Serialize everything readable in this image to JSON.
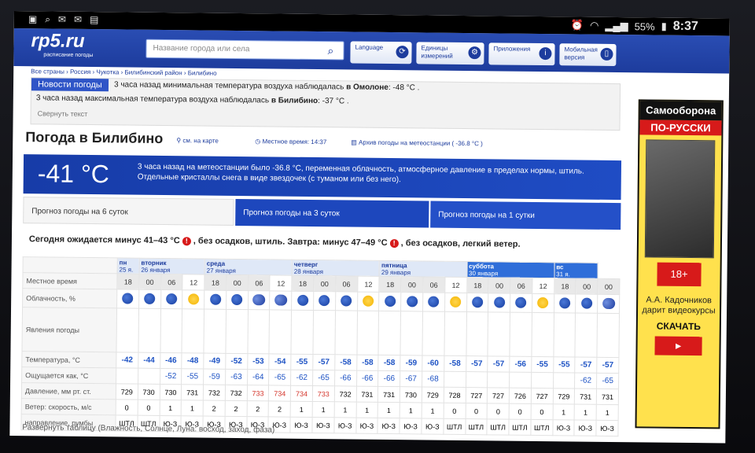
{
  "status_bar": {
    "battery": "55%",
    "time": "8:37"
  },
  "header": {
    "logo": "rp5.ru",
    "logo_sub": "расписание погоды",
    "search_placeholder": "Название города или села",
    "language": "Language",
    "units": "Единицы измерений",
    "apps": "Приложения",
    "mobile": "Мобильная версия"
  },
  "breadcrumb": "Все страны › Россия › Чукотка › Билибинский район › Билибино",
  "news": {
    "tab": "Новости погоды",
    "line1_pre": "3 часа назад минимальная температура воздуха наблюдалась ",
    "line1_bold": "в Омолоне",
    "line1_val": ": -48 °C .",
    "line2_pre": "3 часа назад максимальная температура воздуха наблюдалась ",
    "line2_bold": "в Билибино",
    "line2_val": ": -37 °C .",
    "collapse": "Свернуть текст"
  },
  "title": {
    "text": "Погода в Билибино",
    "map_link": "см. на карте",
    "local_time": "Местное время: 14:37",
    "archive": "Архив погоды на метеостанции ( -36.8 °C )"
  },
  "current": {
    "temp": "-41 °C",
    "desc": "3 часа назад на метеостанции было -36.8 °C, переменная облачность, атмосферное давление в пределах нормы, штиль. Отдельные кристаллы снега в виде звездочек (с туманом или без него)."
  },
  "tabs": {
    "six": "Прогноз погоды на 6 суток",
    "three": "Прогноз погоды на 3 суток",
    "one": "Прогноз погоды на 1 сутки"
  },
  "summary": {
    "today": "Сегодня ожидается минус 41–43 °C",
    "today_rest": ", без осадков, штиль. Завтра: минус 47–49 °C",
    "tomorrow_rest": ", без осадков, легкий ветер."
  },
  "table": {
    "row_labels": [
      "Местное время",
      "Облачность, %",
      "Явления погоды",
      "Температура, °C",
      "Ощущается как, °C",
      "Давление, мм рт. ст.",
      "Ветер: скорость, м/с",
      "направление, румбы"
    ],
    "days": [
      {
        "name": "пн",
        "date": "25 я.",
        "cols": 1,
        "sunday": false
      },
      {
        "name": "вторник",
        "date": "26 января",
        "cols": 3,
        "sunday": false
      },
      {
        "name": "среда",
        "date": "27 января",
        "cols": 4,
        "sunday": false
      },
      {
        "name": "четверг",
        "date": "28 января",
        "cols": 4,
        "sunday": false
      },
      {
        "name": "пятница",
        "date": "29 января",
        "cols": 4,
        "sunday": false
      },
      {
        "name": "суббота",
        "date": "30 января",
        "cols": 4,
        "sunday": true
      },
      {
        "name": "вс",
        "date": "31 я.",
        "cols": 2,
        "sunday": true
      }
    ],
    "hours": [
      "18",
      "00",
      "06",
      "12",
      "18",
      "00",
      "06",
      "12",
      "18",
      "00",
      "06",
      "12",
      "18",
      "00",
      "06",
      "12",
      "18",
      "00",
      "06",
      "12",
      "18",
      "00",
      "00"
    ],
    "clouds": [
      "night",
      "night",
      "night",
      "sun",
      "night",
      "night",
      "cloud",
      "cloud",
      "night",
      "night",
      "night",
      "sun",
      "night",
      "night",
      "night",
      "sun",
      "night",
      "night",
      "night",
      "sun",
      "night",
      "night",
      "cloud"
    ],
    "temp": [
      "-42",
      "-44",
      "-46",
      "-48",
      "-49",
      "-52",
      "-53",
      "-54",
      "-55",
      "-57",
      "-58",
      "-58",
      "-58",
      "-59",
      "-60",
      "-58",
      "-57",
      "-57",
      "-56",
      "-55",
      "-55",
      "-57",
      "-57"
    ],
    "feels": [
      "",
      "",
      "-52",
      "-55",
      "-59",
      "-63",
      "-64",
      "-65",
      "-62",
      "-65",
      "-66",
      "-66",
      "-66",
      "-67",
      "-68",
      "",
      "",
      "",
      "",
      "",
      "",
      "-62",
      "-65"
    ],
    "pressure": [
      "729",
      "730",
      "730",
      "731",
      "732",
      "732",
      "733",
      "734",
      "734",
      "733",
      "732",
      "731",
      "731",
      "730",
      "729",
      "728",
      "727",
      "727",
      "726",
      "727",
      "729",
      "731",
      "731"
    ],
    "pressure_red": [
      false,
      false,
      false,
      false,
      false,
      false,
      true,
      true,
      true,
      true,
      false,
      false,
      false,
      false,
      false,
      false,
      false,
      false,
      false,
      false,
      false,
      false,
      false
    ],
    "wind": [
      "0",
      "0",
      "1",
      "1",
      "2",
      "2",
      "2",
      "2",
      "1",
      "1",
      "1",
      "1",
      "1",
      "1",
      "1",
      "0",
      "0",
      "0",
      "0",
      "0",
      "1",
      "1",
      "1"
    ],
    "dir": [
      "ШТЛ",
      "ШТЛ",
      "Ю-З",
      "Ю-З",
      "Ю-З",
      "Ю-З",
      "Ю-З",
      "Ю-З",
      "Ю-З",
      "Ю-З",
      "Ю-З",
      "Ю-З",
      "Ю-З",
      "Ю-З",
      "Ю-З",
      "ШТЛ",
      "ШТЛ",
      "ШТЛ",
      "ШТЛ",
      "ШТЛ",
      "Ю-З",
      "Ю-З",
      "Ю-З"
    ]
  },
  "expand_table": "Развернуть таблицу (Влажность, Солнце, Луна: восход, заход, фаза)",
  "ad": {
    "head1": "Самооборона",
    "head2": "ПО-РУССКИ",
    "age": "18+",
    "text": "А.А. Кадочников дарит видеокурсы",
    "cta": "СКАЧАТЬ",
    "play": "►"
  }
}
